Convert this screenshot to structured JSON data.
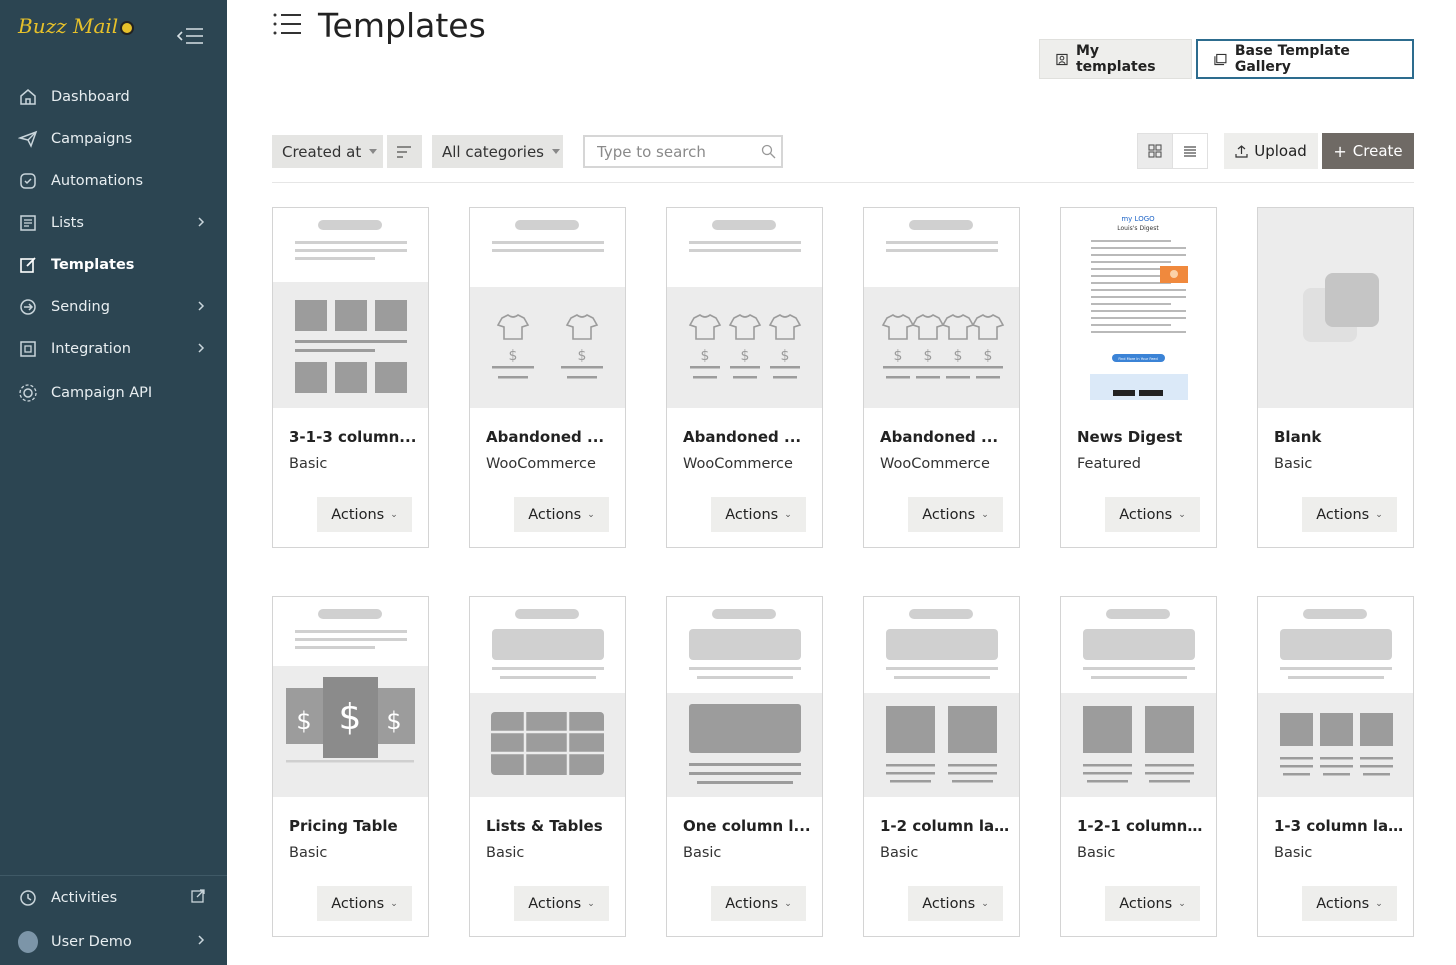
{
  "brand": {
    "logo_text": "Buzz Mail"
  },
  "sidebar": {
    "items": [
      {
        "label": "Dashboard",
        "icon": "home-icon",
        "chevron": false,
        "active": false
      },
      {
        "label": "Campaigns",
        "icon": "paper-plane-icon",
        "chevron": false,
        "active": false
      },
      {
        "label": "Automations",
        "icon": "automation-icon",
        "chevron": false,
        "active": false
      },
      {
        "label": "Lists",
        "icon": "list-icon",
        "chevron": true,
        "active": false
      },
      {
        "label": "Templates",
        "icon": "template-edit-icon",
        "chevron": false,
        "active": true
      },
      {
        "label": "Sending",
        "icon": "sending-icon",
        "chevron": true,
        "active": false
      },
      {
        "label": "Integration",
        "icon": "integration-icon",
        "chevron": true,
        "active": false
      },
      {
        "label": "Campaign API",
        "icon": "api-gear-icon",
        "chevron": false,
        "active": false
      }
    ],
    "bottom": {
      "activities": "Activities",
      "user": "User Demo"
    }
  },
  "page": {
    "title": "Templates",
    "tabs": {
      "my": "My templates",
      "base": "Base Template Gallery"
    }
  },
  "toolbar": {
    "sort_label": "Created at",
    "category_label": "All categories",
    "search_placeholder": "Type to search",
    "upload_label": "Upload",
    "create_label": "Create"
  },
  "cards": [
    {
      "name": "3-1-3 column...",
      "category": "Basic",
      "actions": "Actions",
      "thumb": "313"
    },
    {
      "name": "Abandoned ...",
      "category": "WooCommerce",
      "actions": "Actions",
      "thumb": "shirt2"
    },
    {
      "name": "Abandoned ...",
      "category": "WooCommerce",
      "actions": "Actions",
      "thumb": "shirt3"
    },
    {
      "name": "Abandoned ...",
      "category": "WooCommerce",
      "actions": "Actions",
      "thumb": "shirt4"
    },
    {
      "name": "News Digest",
      "category": "Featured",
      "actions": "Actions",
      "thumb": "news"
    },
    {
      "name": "Blank",
      "category": "Basic",
      "actions": "Actions",
      "thumb": "blank"
    },
    {
      "name": "Pricing Table",
      "category": "Basic",
      "actions": "Actions",
      "thumb": "pricing"
    },
    {
      "name": "Lists & Tables",
      "category": "Basic",
      "actions": "Actions",
      "thumb": "table"
    },
    {
      "name": "One column l...",
      "category": "Basic",
      "actions": "Actions",
      "thumb": "one"
    },
    {
      "name": "1-2 column la...",
      "category": "Basic",
      "actions": "Actions",
      "thumb": "12"
    },
    {
      "name": "1-2-1 column ...",
      "category": "Basic",
      "actions": "Actions",
      "thumb": "121"
    },
    {
      "name": "1-3 column la...",
      "category": "Basic",
      "actions": "Actions",
      "thumb": "13"
    }
  ],
  "news_thumb": {
    "logo": "my LOGO",
    "title": "Louis's Digest",
    "button": "Find More In Your Feed"
  }
}
